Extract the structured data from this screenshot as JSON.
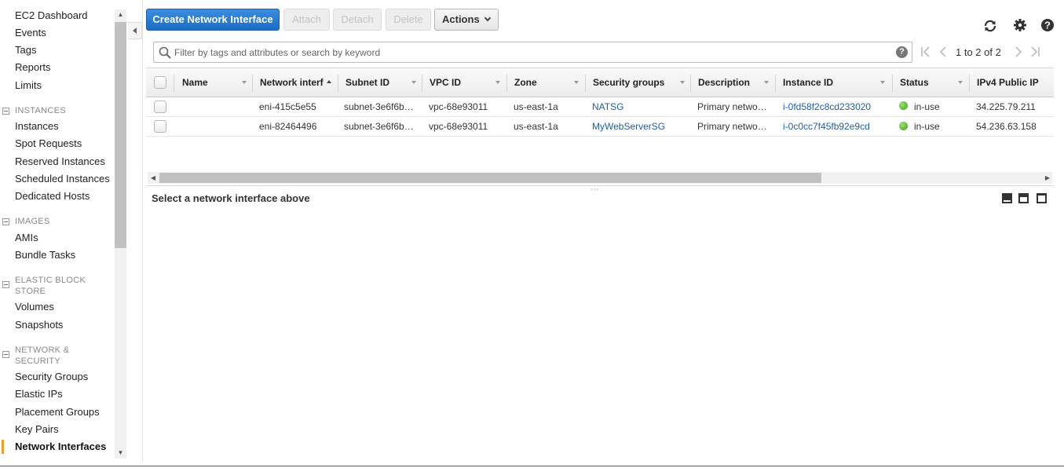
{
  "sidebar": {
    "top_items": [
      {
        "label": "EC2 Dashboard"
      },
      {
        "label": "Events"
      },
      {
        "label": "Tags"
      },
      {
        "label": "Reports"
      },
      {
        "label": "Limits"
      }
    ],
    "sections": [
      {
        "title": "INSTANCES",
        "items": [
          "Instances",
          "Spot Requests",
          "Reserved Instances",
          "Scheduled Instances",
          "Dedicated Hosts"
        ]
      },
      {
        "title": "IMAGES",
        "items": [
          "AMIs",
          "Bundle Tasks"
        ]
      },
      {
        "title": "ELASTIC BLOCK STORE",
        "items": [
          "Volumes",
          "Snapshots"
        ]
      },
      {
        "title": "NETWORK & SECURITY",
        "items": [
          "Security Groups",
          "Elastic IPs",
          "Placement Groups",
          "Key Pairs",
          "Network Interfaces"
        ]
      }
    ],
    "active_item": "Network Interfaces",
    "accent_color": "#f19e28"
  },
  "toolbar": {
    "create_label": "Create Network Interface",
    "attach_label": "Attach",
    "detach_label": "Detach",
    "delete_label": "Delete",
    "actions_label": "Actions",
    "primary_color": "#1b6ec2"
  },
  "top_icons": [
    "refresh-icon",
    "gear-icon",
    "help-icon"
  ],
  "search": {
    "placeholder": "Filter by tags and attributes or search by keyword",
    "value": "",
    "help_glyph": "?"
  },
  "pager": {
    "text": "1 to 2 of 2"
  },
  "table": {
    "columns": [
      "Name",
      "Network interf",
      "Subnet ID",
      "VPC ID",
      "Zone",
      "Security groups",
      "Description",
      "Instance ID",
      "Status",
      "IPv4 Public IP"
    ],
    "rows": [
      {
        "name": "",
        "network_interface": "eni-415c5e55",
        "subnet_id": "subnet-3e6f6b…",
        "vpc_id": "vpc-68e93011",
        "zone": "us-east-1a",
        "security_group": "NATSG",
        "description": "Primary netwo…",
        "instance_id": "i-0fd58f2c8cd233020",
        "status": "in-use",
        "ipv4": "34.225.79.211"
      },
      {
        "name": "",
        "network_interface": "eni-82464496",
        "subnet_id": "subnet-3e6f6b…",
        "vpc_id": "vpc-68e93011",
        "zone": "us-east-1a",
        "security_group": "MyWebServerSG",
        "description": "Primary netwo…",
        "instance_id": "i-0c0cc7f45fb92e9cd",
        "status": "in-use",
        "ipv4": "54.236.63.158"
      }
    ],
    "status_color": "#3aa31a",
    "link_color": "#1e5ea8"
  },
  "detail": {
    "message": "Select a network interface above"
  }
}
